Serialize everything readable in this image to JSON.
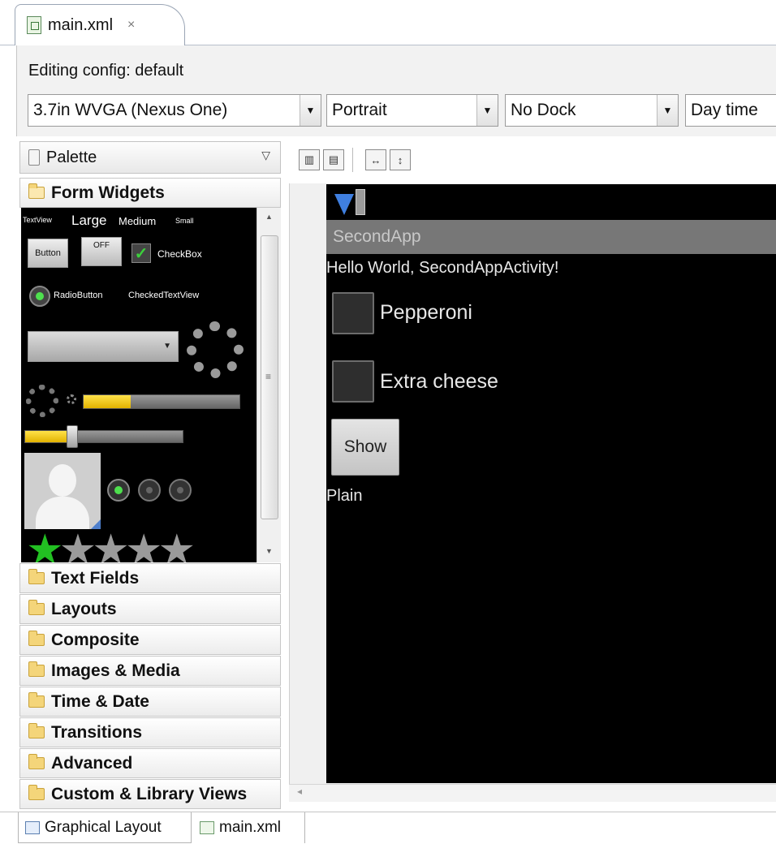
{
  "editor_tab": {
    "label": "main.xml",
    "close_glyph": "×",
    "icon": "xml-file-icon"
  },
  "config": {
    "label": "Editing config: default",
    "device": "3.7in WVGA (Nexus One)",
    "orientation": "Portrait",
    "dock": "No Dock",
    "time": "Day time"
  },
  "palette": {
    "title": "Palette",
    "categories": [
      {
        "label": "Form Widgets",
        "open": true
      },
      {
        "label": "Text Fields"
      },
      {
        "label": "Layouts"
      },
      {
        "label": "Composite"
      },
      {
        "label": "Images & Media"
      },
      {
        "label": "Time & Date"
      },
      {
        "label": "Transitions"
      },
      {
        "label": "Advanced"
      },
      {
        "label": "Custom & Library Views"
      }
    ],
    "widgets": {
      "textview": "TextView",
      "large": "Large",
      "medium": "Medium",
      "small": "Small",
      "button": "Button",
      "toggle": "OFF",
      "checkbox": "CheckBox",
      "radio": "RadioButton",
      "checked_textview": "CheckedTextView",
      "progress_fraction": 0.3,
      "seekbar_fraction": 0.3,
      "rating_stars": 1,
      "rating_total": 5
    }
  },
  "device_screen": {
    "app_title": "SecondApp",
    "hello_text": "Hello World, SecondAppActivity!",
    "checkboxes": [
      {
        "label": "Pepperoni",
        "checked": false
      },
      {
        "label": "Extra cheese",
        "checked": false
      }
    ],
    "show_button": "Show",
    "plain_text": "Plain"
  },
  "bottom_tabs": [
    {
      "label": "Graphical Layout",
      "active": true
    },
    {
      "label": "main.xml",
      "active": false
    }
  ],
  "colors": {
    "progress": "#f4c800",
    "star_active": "#22c022",
    "title_bar": "#777777"
  }
}
